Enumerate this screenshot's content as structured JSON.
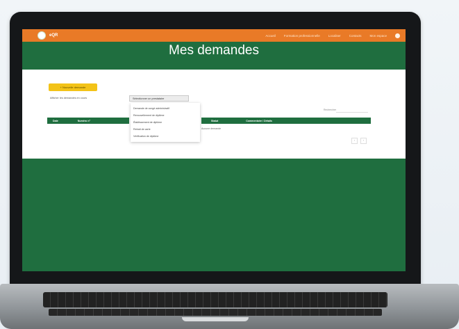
{
  "app": {
    "name": "eQR"
  },
  "nav": {
    "items": [
      "Accueil",
      "Formation professionnelle",
      "Localiser",
      "Contacts",
      "Mon espace"
    ]
  },
  "page": {
    "title": "Mes demandes"
  },
  "toolbar": {
    "new_request_label": "+ Nouvelle demande",
    "filter_label": "Afficher les demandes en cours",
    "select_value": "Sélectionner un prestataire"
  },
  "dropdown": {
    "options": [
      "Demande de congé administratif",
      "Renouvellement de diplôme",
      "Établissement de diplôme",
      "Retrait de carte",
      "Vérification de diplôme"
    ]
  },
  "table": {
    "search_label": "Rechercher",
    "left_columns": [
      "Date",
      "Numéro n°"
    ],
    "right_columns": [
      "Statut",
      "Commentaire / Détails"
    ],
    "empty_message": "Aucune demande",
    "pager": [
      "‹",
      "›"
    ]
  },
  "colors": {
    "green": "#1f6e3f",
    "orange": "#e97a27",
    "yellow": "#f3c318"
  }
}
